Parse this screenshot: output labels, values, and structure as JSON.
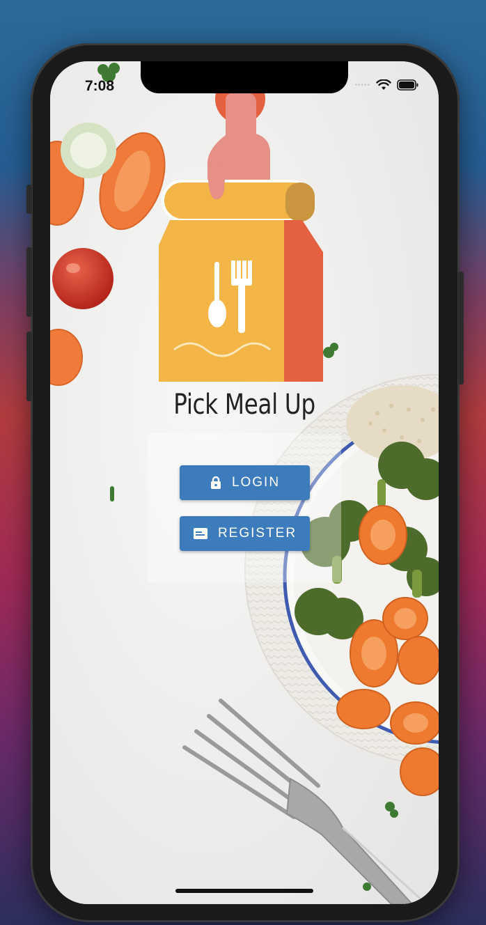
{
  "status_bar": {
    "time": "7:08"
  },
  "app": {
    "title": "Pick Meal Up"
  },
  "buttons": {
    "login_label": "LOGIN",
    "register_label": "REGISTER"
  },
  "icons": {
    "login": "lock-icon",
    "register": "id-card-icon",
    "wifi": "wifi-icon",
    "battery": "battery-icon",
    "logo": "meal-bag-logo"
  },
  "colors": {
    "button": "#3d7cbc",
    "logo_bag": "#f3b545",
    "logo_side": "#e4603e",
    "logo_hand": "#e69087"
  }
}
